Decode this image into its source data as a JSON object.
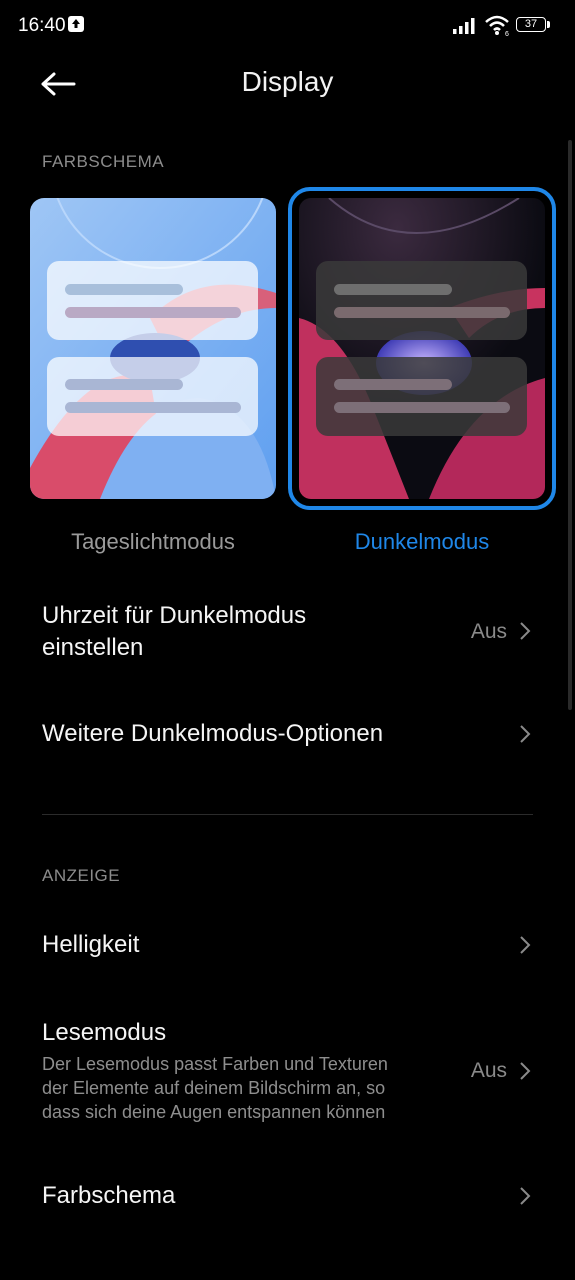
{
  "status_bar": {
    "time": "16:40",
    "battery": "37",
    "icons": [
      "upload-notification-icon",
      "signal-icon",
      "wifi-icon",
      "battery-icon"
    ]
  },
  "header": {
    "title": "Display",
    "back_icon": "arrow-left-icon"
  },
  "color_scheme_section": {
    "label": "FARBSCHEMA",
    "modes": [
      {
        "label": "Tageslichtmodus",
        "selected": false
      },
      {
        "label": "Dunkelmodus",
        "selected": true
      }
    ],
    "accent_color": "#1f87e8"
  },
  "dark_rows": [
    {
      "title_line1": "Uhrzeit für Dunkelmodus",
      "title_line2": "einstellen",
      "value": "Aus"
    },
    {
      "title": "Weitere Dunkelmodus-Optionen"
    }
  ],
  "display_section": {
    "label": "ANZEIGE",
    "rows": [
      {
        "title": "Helligkeit"
      },
      {
        "title": "Lesemodus",
        "subtitle_line1": "Der Lesemodus passt Farben und Texturen",
        "subtitle_line2": "der Elemente auf deinem Bildschirm an, so",
        "subtitle_line3": "dass sich deine Augen entspannen können",
        "value": "Aus"
      },
      {
        "title": "Farbschema"
      }
    ]
  }
}
